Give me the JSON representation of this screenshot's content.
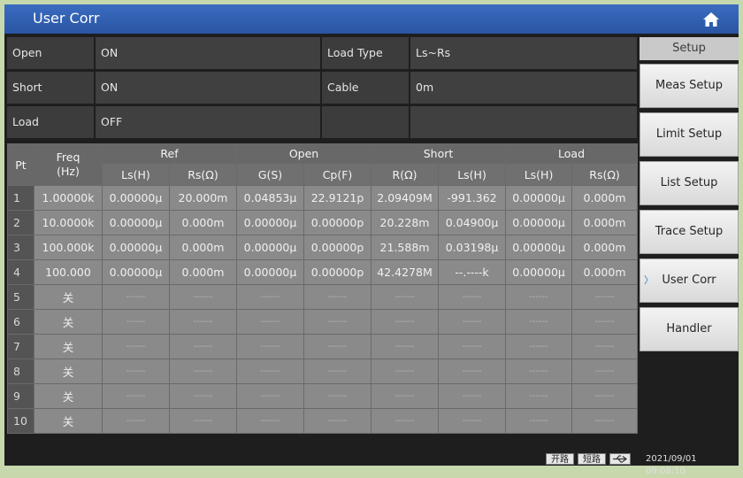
{
  "title": "User Corr",
  "info": [
    {
      "label": "Open",
      "value": "ON",
      "label2": "Load Type",
      "value2": "Ls~Rs"
    },
    {
      "label": "Short",
      "value": "ON",
      "label2": "Cable",
      "value2": "0m"
    },
    {
      "label": "Load",
      "value": "OFF",
      "label2": "",
      "value2": ""
    }
  ],
  "table": {
    "group_headers": {
      "pt": "Pt",
      "freq": "Freq\n(Hz)",
      "ref": "Ref",
      "open": "Open",
      "short": "Short",
      "load": "Load"
    },
    "sub_headers": [
      "Ls(H)",
      "Rs(Ω)",
      "G(S)",
      "Cp(F)",
      "R(Ω)",
      "Ls(H)",
      "Ls(H)",
      "Rs(Ω)"
    ],
    "rows": [
      [
        "1",
        "1.00000k",
        "0.00000μ",
        "20.000m",
        "0.04853μ",
        "22.9121p",
        "2.09409M",
        "-991.362",
        "0.00000μ",
        "0.000m"
      ],
      [
        "2",
        "10.0000k",
        "0.00000μ",
        "0.000m",
        "0.00000μ",
        "0.00000p",
        "20.228m",
        "0.04900μ",
        "0.00000μ",
        "0.000m"
      ],
      [
        "3",
        "100.000k",
        "0.00000μ",
        "0.000m",
        "0.00000μ",
        "0.00000p",
        "21.588m",
        "0.03198μ",
        "0.00000μ",
        "0.000m"
      ],
      [
        "4",
        "100.000",
        "0.00000μ",
        "0.000m",
        "0.00000μ",
        "0.00000p",
        "42.4278M",
        "--.----k",
        "0.00000μ",
        "0.000m"
      ],
      [
        "5",
        "关",
        "------",
        "------",
        "------",
        "------",
        "------",
        "------",
        "------",
        "------"
      ],
      [
        "6",
        "关",
        "------",
        "------",
        "------",
        "------",
        "------",
        "------",
        "------",
        "------"
      ],
      [
        "7",
        "关",
        "------",
        "------",
        "------",
        "------",
        "------",
        "------",
        "------",
        "------"
      ],
      [
        "8",
        "关",
        "------",
        "------",
        "------",
        "------",
        "------",
        "------",
        "------",
        "------"
      ],
      [
        "9",
        "关",
        "------",
        "------",
        "------",
        "------",
        "------",
        "------",
        "------",
        "------"
      ],
      [
        "10",
        "关",
        "------",
        "------",
        "------",
        "------",
        "------",
        "------",
        "------",
        "------"
      ]
    ]
  },
  "sidebar": {
    "header": "Setup",
    "buttons": [
      "Meas Setup",
      "Limit Setup",
      "List Setup",
      "Trace Setup",
      "User Corr",
      "Handler"
    ],
    "active_index": 4
  },
  "status": {
    "open_label": "开路",
    "short_label": "短路",
    "usb_icon": "usb-icon",
    "datetime": "2021/09/01 09:08:10"
  },
  "colors": {
    "titlebar": "#2f5fb3",
    "accent": "#3c78c0"
  }
}
